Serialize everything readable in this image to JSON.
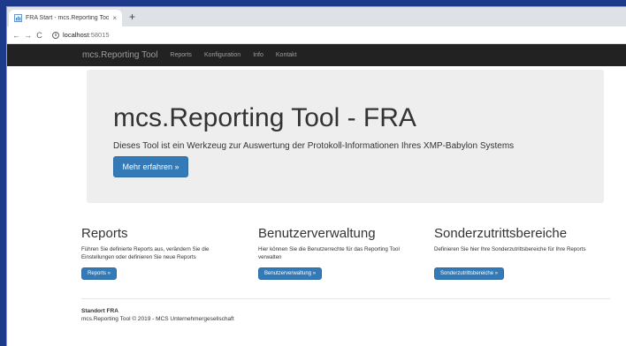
{
  "browser": {
    "tab_title": "FRA Start - mcs.Reporting Tool",
    "tab_close": "×",
    "new_tab": "+",
    "back": "←",
    "forward": "→",
    "reload": "C",
    "info": "i",
    "url_host": "localhost",
    "url_port": ":58015"
  },
  "navbar": {
    "brand": "mcs.Reporting Tool",
    "links": [
      "Reports",
      "Konfiguration",
      "Info",
      "Kontakt"
    ]
  },
  "jumbotron": {
    "title": "mcs.Reporting Tool - FRA",
    "lead": "Dieses Tool ist ein Werkzeug zur Auswertung der Protokoll-Informationen Ihres XMP-Babylon Systems",
    "button": "Mehr erfahren »"
  },
  "columns": [
    {
      "title": "Reports",
      "text": "Führen Sie definierte Reports aus, verändern Sie die Einstellungen oder definieren Sie neue Reports",
      "button": "Reports »"
    },
    {
      "title": "Benutzerverwaltung",
      "text": "Hier können Sie die Benutzerrechte für das Reporting Tool verwalten",
      "button": "Benutzerverwaltung »"
    },
    {
      "title": "Sonderzutrittsbereiche",
      "text": "Definieren Sie hier Ihre Sonderzutrittsbereiche für Ihre Reports",
      "button": "Sonderzutrittsbereiche »"
    }
  ],
  "footer": {
    "location": "Standort FRA",
    "copyright": "mcs.Reporting Tool © 2019 - MCS Unternehmergesellschaft"
  },
  "colors": {
    "navbar_bg": "#222222",
    "jumbotron_bg": "#eeeeee",
    "primary": "#337ab7"
  }
}
